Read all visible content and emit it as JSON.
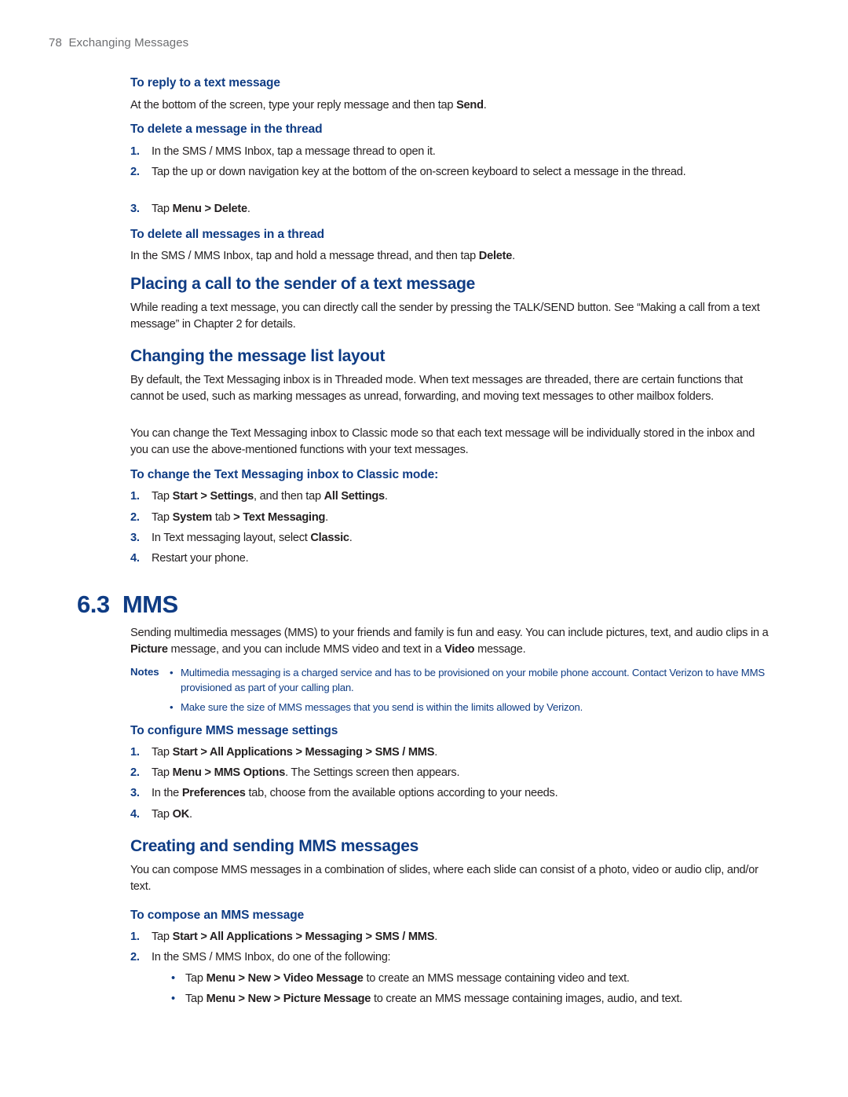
{
  "running_header": {
    "page_number": "78",
    "chapter": "Exchanging Messages"
  },
  "reply": {
    "heading": "To reply to a text message",
    "text_before": "At the bottom of the screen, type your reply message and then tap ",
    "bold": "Send",
    "text_after": "."
  },
  "delete_one": {
    "heading": "To delete a message in the thread",
    "steps": [
      {
        "num": "1.",
        "text": "In the SMS / MMS Inbox, tap a message thread to open it."
      },
      {
        "num": "2.",
        "text": "Tap the up or down navigation key at the bottom of the on-screen keyboard to select a message in the thread."
      },
      {
        "num": "3.",
        "pre": "Tap ",
        "b1": "Menu > Delete",
        "post": "."
      }
    ]
  },
  "delete_all": {
    "heading": "To delete all messages in a thread",
    "text_before": "In the SMS / MMS Inbox, tap and hold a message thread, and then tap ",
    "bold": "Delete",
    "text_after": "."
  },
  "placing_call": {
    "heading": "Placing a call to the sender of a text message",
    "text": "While reading a text message, you can directly call the sender by pressing the TALK/SEND button. See “Making a call from a text message” in Chapter 2 for details."
  },
  "layout": {
    "heading": "Changing the message list layout",
    "para1": "By default, the Text Messaging inbox is in Threaded mode. When text messages are threaded, there are certain functions that cannot be used, such as marking messages as unread, forwarding, and moving text messages to other mailbox folders.",
    "para2": "You can change the Text Messaging inbox to Classic mode so that each text message will be individually stored in the inbox and you can use the above-mentioned functions with your text messages.",
    "subheading": "To change the Text Messaging inbox to Classic mode:",
    "steps": [
      {
        "num": "1.",
        "pre": "Tap ",
        "b1": "Start > Settings",
        "mid": ", and then tap ",
        "b2": "All Settings",
        "post": "."
      },
      {
        "num": "2.",
        "pre": "Tap ",
        "b1": "System",
        "mid": " tab ",
        "b2": "> Text Messaging",
        "post": "."
      },
      {
        "num": "3.",
        "pre": "In Text messaging layout, select ",
        "b1": "Classic",
        "post": "."
      },
      {
        "num": "4.",
        "pre": "Restart your phone."
      }
    ]
  },
  "mms": {
    "section_title": "6.3  MMS",
    "intro_pre": "Sending multimedia messages (MMS) to your friends and family is fun and easy. You can include pictures, text, and audio clips in a ",
    "intro_b1": "Picture",
    "intro_mid": " message, and you can include MMS video and text in a ",
    "intro_b2": "Video",
    "intro_post": " message.",
    "notes_label": "Notes",
    "notes": [
      "Multimedia messaging is a charged service and has to be provisioned on your mobile phone account. Contact Verizon to have MMS provisioned as part of your calling plan.",
      "Make sure the size of MMS messages that you send is within the limits allowed by Verizon."
    ],
    "configure": {
      "heading": "To configure MMS message settings",
      "steps": [
        {
          "num": "1.",
          "pre": "Tap ",
          "b1": "Start > All Applications > Messaging > SMS / MMS",
          "post": "."
        },
        {
          "num": "2.",
          "pre": "Tap ",
          "b1": "Menu > MMS Options",
          "post": ". The Settings screen then appears."
        },
        {
          "num": "3.",
          "pre": "In the ",
          "b1": "Preferences",
          "post": " tab, choose from the available options according to your needs."
        },
        {
          "num": "4.",
          "pre": "Tap ",
          "b1": "OK",
          "post": "."
        }
      ]
    },
    "creating": {
      "heading": "Creating and sending MMS messages",
      "text": "You can compose MMS messages in a combination of slides, where each slide can consist of a photo, video or audio clip, and/or text.",
      "subheading": "To compose an MMS message",
      "steps": [
        {
          "num": "1.",
          "pre": "Tap ",
          "b1": "Start > All Applications > Messaging > SMS / MMS",
          "post": "."
        },
        {
          "num": "2.",
          "pre": "In the SMS / MMS Inbox, do one of the following:"
        }
      ],
      "bullets": [
        {
          "pre": "Tap ",
          "b1": "Menu > New > Video Message",
          "post": " to create an MMS message containing video and text."
        },
        {
          "pre": "Tap ",
          "b1": "Menu > New > Picture Message",
          "post": " to create an MMS message containing images, audio, and text."
        }
      ]
    }
  }
}
